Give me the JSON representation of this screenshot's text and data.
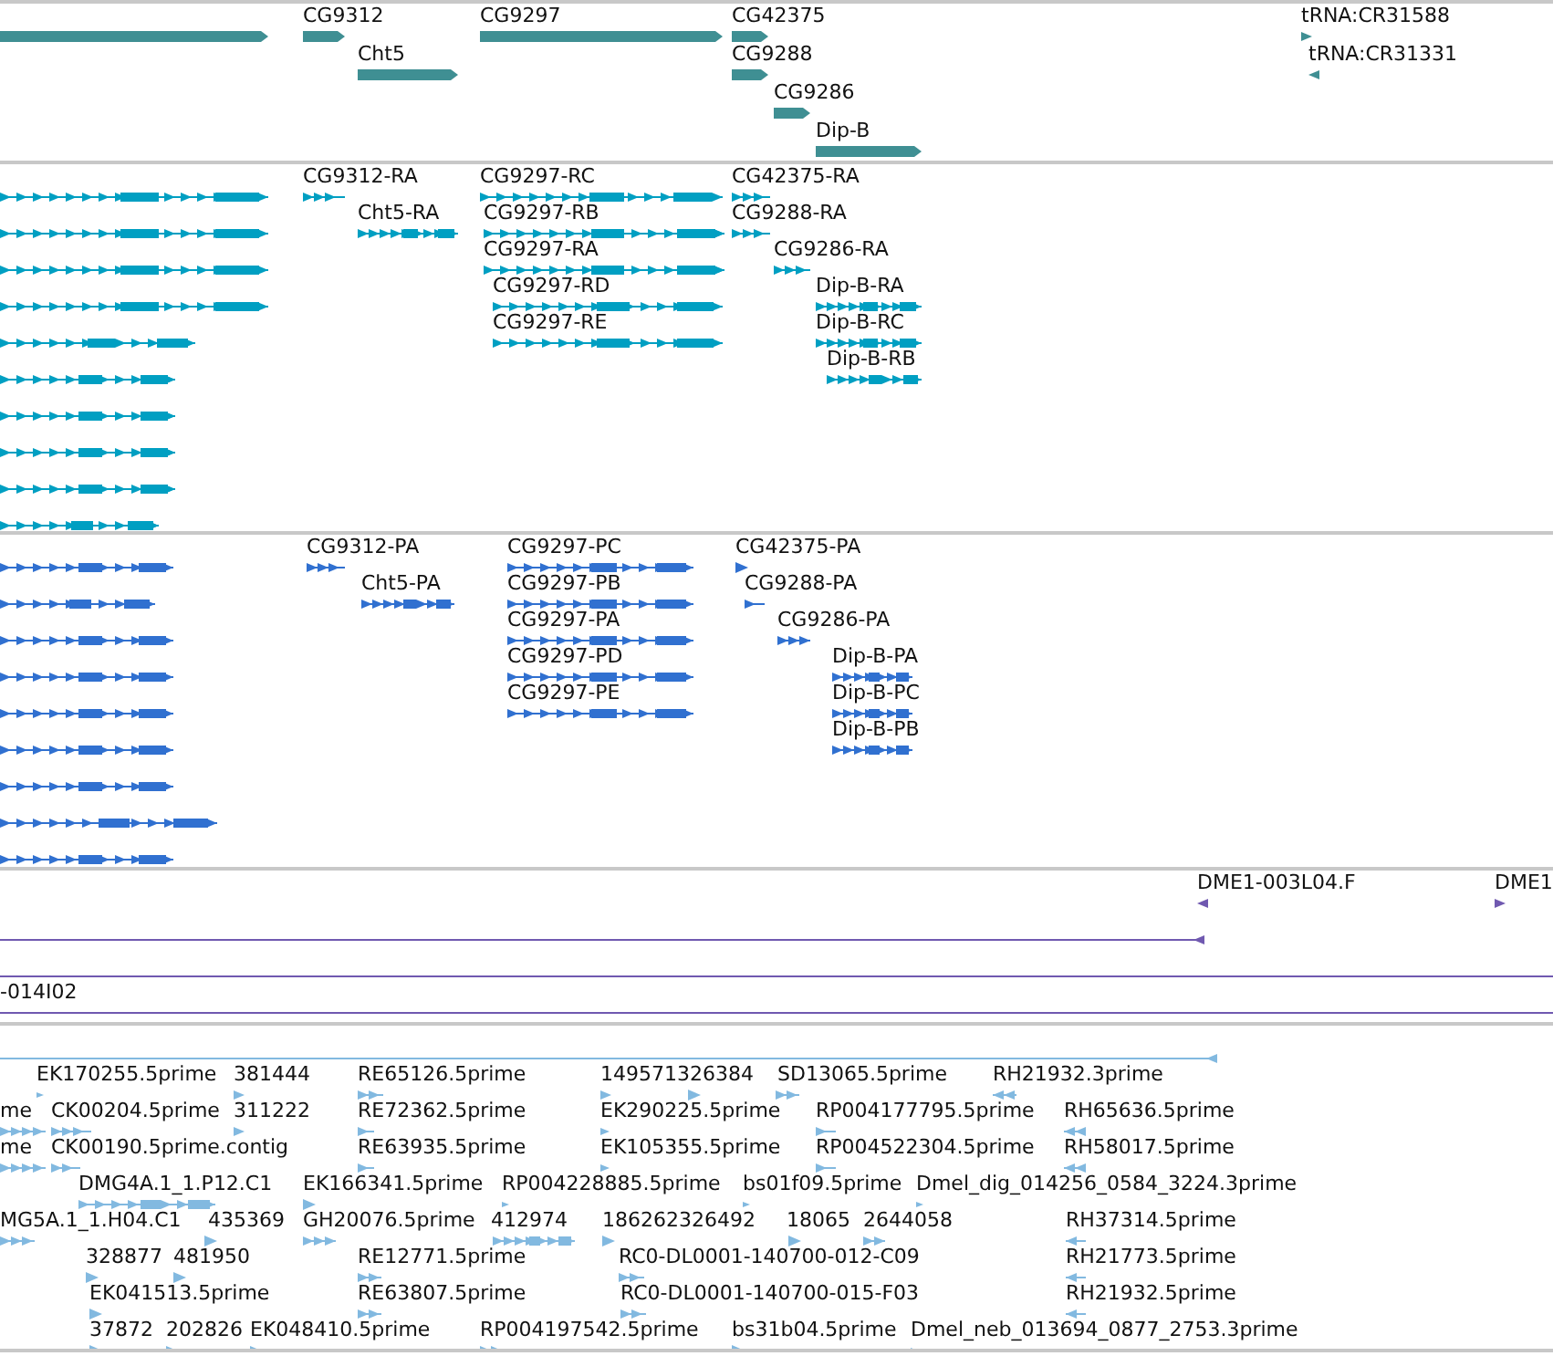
{
  "tracks": [
    {
      "kind": "genes",
      "color": "#3f8f93",
      "features": [
        {
          "label": "CG9312",
          "kind": "forward"
        },
        {
          "label": "Cht5",
          "kind": "forward"
        },
        {
          "label": "CG9297",
          "kind": "forward"
        },
        {
          "label": "CG42375",
          "kind": "forward"
        },
        {
          "label": "CG9288",
          "kind": "forward"
        },
        {
          "label": "CG9286",
          "kind": "forward"
        },
        {
          "label": "Dip-B",
          "kind": "forward"
        },
        {
          "label": "tRNA:CR31588",
          "kind": "forward"
        },
        {
          "label": "tRNA:CR31331",
          "kind": "reverse"
        }
      ]
    },
    {
      "kind": "transcripts",
      "color": "#009fc2",
      "features": [
        {
          "label": "CG9312-RA",
          "kind": "forward"
        },
        {
          "label": "Cht5-RA",
          "kind": "forward"
        },
        {
          "label": "CG9297-RC",
          "kind": "forward"
        },
        {
          "label": "CG9297-RB",
          "kind": "forward"
        },
        {
          "label": "CG9297-RA",
          "kind": "forward"
        },
        {
          "label": "CG9297-RD",
          "kind": "forward"
        },
        {
          "label": "CG9297-RE",
          "kind": "forward"
        },
        {
          "label": "CG42375-RA",
          "kind": "forward"
        },
        {
          "label": "CG9288-RA",
          "kind": "forward"
        },
        {
          "label": "CG9286-RA",
          "kind": "forward"
        },
        {
          "label": "Dip-B-RA",
          "kind": "forward"
        },
        {
          "label": "Dip-B-RC",
          "kind": "forward"
        },
        {
          "label": "Dip-B-RB",
          "kind": "forward"
        }
      ]
    },
    {
      "kind": "transcripts",
      "color": "#3070d0",
      "features": [
        {
          "label": "CG9312-PA",
          "kind": "forward"
        },
        {
          "label": "Cht5-PA",
          "kind": "forward"
        },
        {
          "label": "CG9297-PC",
          "kind": "forward"
        },
        {
          "label": "CG9297-PB",
          "kind": "forward"
        },
        {
          "label": "CG9297-PA",
          "kind": "forward"
        },
        {
          "label": "CG9297-PD",
          "kind": "forward"
        },
        {
          "label": "CG9297-PE",
          "kind": "forward"
        },
        {
          "label": "CG42375-PA",
          "kind": "forward"
        },
        {
          "label": "CG9288-PA",
          "kind": "forward"
        },
        {
          "label": "CG9286-PA",
          "kind": "forward"
        },
        {
          "label": "Dip-B-PA",
          "kind": "forward"
        },
        {
          "label": "Dip-B-PC",
          "kind": "forward"
        },
        {
          "label": "Dip-B-PB",
          "kind": "forward"
        }
      ]
    },
    {
      "kind": "clones",
      "color": "#7059b0",
      "features": [
        {
          "label": "DME1-003L04.F",
          "kind": "reverse"
        },
        {
          "label": "DME1",
          "kind": "forward"
        },
        {
          "label": "-014I02",
          "kind": "forward"
        }
      ]
    },
    {
      "kind": "ests",
      "color": "#82b9e0",
      "features": [
        {
          "label": "EK170255.5prime",
          "kind": "forward"
        },
        {
          "label": "381444",
          "kind": "forward"
        },
        {
          "label": "RE65126.5prime",
          "kind": "forward"
        },
        {
          "label": "149571326384",
          "kind": "forward"
        },
        {
          "label": "SD13065.5prime",
          "kind": "forward"
        },
        {
          "label": "RH21932.3prime",
          "kind": "reverse"
        },
        {
          "label": "me",
          "kind": "forward"
        },
        {
          "label": "CK00204.5prime",
          "kind": "forward"
        },
        {
          "label": "311222",
          "kind": "forward"
        },
        {
          "label": "RE72362.5prime",
          "kind": "forward"
        },
        {
          "label": "EK290225.5prime",
          "kind": "forward"
        },
        {
          "label": "RP004177795.5prime",
          "kind": "forward"
        },
        {
          "label": "RH65636.5prime",
          "kind": "reverse"
        },
        {
          "label": "me",
          "kind": "forward"
        },
        {
          "label": "CK00190.5prime.contig",
          "kind": "forward"
        },
        {
          "label": "RE63935.5prime",
          "kind": "forward"
        },
        {
          "label": "EK105355.5prime",
          "kind": "forward"
        },
        {
          "label": "RP004522304.5prime",
          "kind": "forward"
        },
        {
          "label": "RH58017.5prime",
          "kind": "reverse"
        },
        {
          "label": "DMG4A.1_1.P12.C1",
          "kind": "forward"
        },
        {
          "label": "EK166341.5prime",
          "kind": "forward"
        },
        {
          "label": "RP004228885.5prime",
          "kind": "forward"
        },
        {
          "label": "bs01f09.5prime",
          "kind": "forward"
        },
        {
          "label": "Dmel_dig_014256_0584_3224.3prime",
          "kind": "forward"
        },
        {
          "label": "MG5A.1_1.H04.C1",
          "kind": "forward"
        },
        {
          "label": "435369",
          "kind": "forward"
        },
        {
          "label": "GH20076.5prime",
          "kind": "forward"
        },
        {
          "label": "412974",
          "kind": "forward"
        },
        {
          "label": "186262326492",
          "kind": "forward"
        },
        {
          "label": "18065",
          "kind": "forward"
        },
        {
          "label": "2644058",
          "kind": "forward"
        },
        {
          "label": "RH37314.5prime",
          "kind": "reverse"
        },
        {
          "label": "328877",
          "kind": "forward"
        },
        {
          "label": "481950",
          "kind": "forward"
        },
        {
          "label": "RE12771.5prime",
          "kind": "forward"
        },
        {
          "label": "RC0-DL0001-140700-012-C09",
          "kind": "forward"
        },
        {
          "label": "RH21773.5prime",
          "kind": "reverse"
        },
        {
          "label": "EK041513.5prime",
          "kind": "forward"
        },
        {
          "label": "RE63807.5prime",
          "kind": "forward"
        },
        {
          "label": "RC0-DL0001-140700-015-F03",
          "kind": "forward"
        },
        {
          "label": "RH21932.5prime",
          "kind": "reverse"
        },
        {
          "label": "37872",
          "kind": "forward"
        },
        {
          "label": "202826",
          "kind": "forward"
        },
        {
          "label": "EK048410.5prime",
          "kind": "forward"
        },
        {
          "label": "RP004197542.5prime",
          "kind": "forward"
        },
        {
          "label": "bs31b04.5prime",
          "kind": "forward"
        },
        {
          "label": "Dmel_neb_013694_0877_2753.3prime",
          "kind": "forward"
        }
      ]
    }
  ]
}
